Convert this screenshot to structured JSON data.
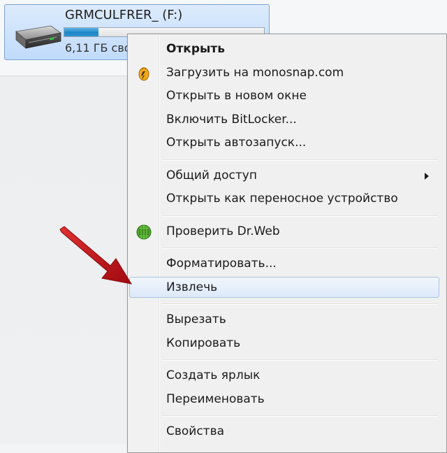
{
  "drive": {
    "name": "GRMCULFRER_ (F:)",
    "free_text": "6,11 ГБ сво",
    "usage_fraction": 0.17,
    "icon": "removable-drive-icon"
  },
  "context_menu": {
    "items": [
      {
        "label": "Открыть",
        "bold": true,
        "icon": null
      },
      {
        "label": "Загрузить на monosnap.com",
        "icon": "monosnap-icon"
      },
      {
        "label": "Открыть в новом окне"
      },
      {
        "label": "Включить BitLocker..."
      },
      {
        "label": "Открыть автозапуск..."
      },
      {
        "separator": true
      },
      {
        "label": "Общий доступ",
        "submenu": true
      },
      {
        "label": "Открыть как переносное устройство"
      },
      {
        "separator": true
      },
      {
        "label": "Проверить Dr.Web",
        "icon": "drweb-icon"
      },
      {
        "separator": true
      },
      {
        "label": "Форматировать..."
      },
      {
        "label": "Извлечь",
        "highlighted": true
      },
      {
        "separator": true
      },
      {
        "label": "Вырезать"
      },
      {
        "label": "Копировать"
      },
      {
        "separator": true
      },
      {
        "label": "Создать ярлык"
      },
      {
        "label": "Переименовать"
      },
      {
        "separator": true
      },
      {
        "label": "Свойства"
      }
    ]
  },
  "annotation": {
    "arrow_color": "#d0121a",
    "arrow_points_to": "Извлечь"
  }
}
